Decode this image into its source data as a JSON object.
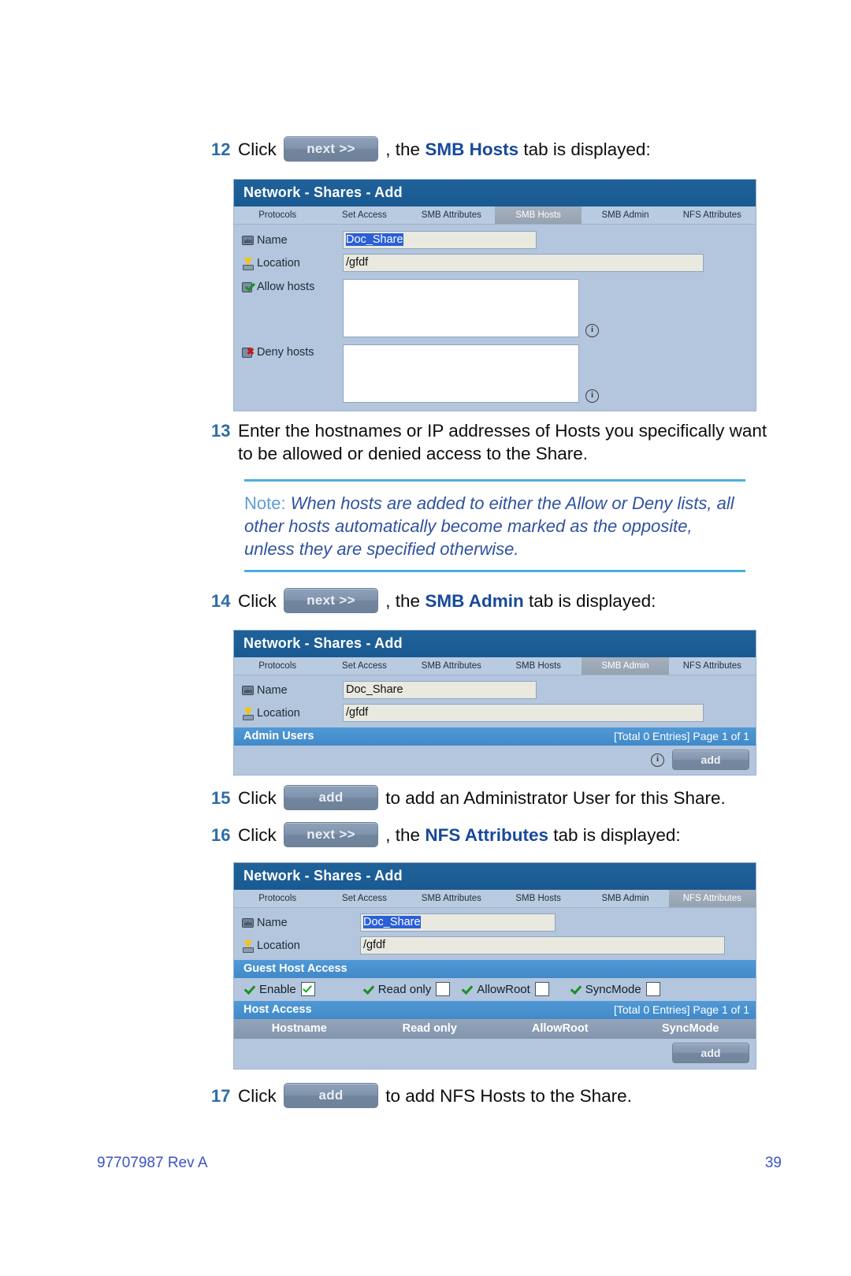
{
  "steps": {
    "s12": {
      "num": "12",
      "pre": "Click",
      "button": "next >>",
      "mid": ", the ",
      "bold": "SMB Hosts",
      "post": " tab is displayed:"
    },
    "s13": {
      "num": "13",
      "text": "Enter the hostnames or IP addresses of Hosts you specifically want to be allowed or denied access to the Share."
    },
    "s14": {
      "num": "14",
      "pre": "Click",
      "button": "next >>",
      "mid": ", the ",
      "bold": "SMB Admin",
      "post": " tab is displayed:"
    },
    "s15": {
      "num": "15",
      "pre": "Click",
      "button": "add",
      "post": "to add an Administrator User for this Share."
    },
    "s16": {
      "num": "16",
      "pre": "Click",
      "button": "next >>",
      "mid": ", the ",
      "bold": "NFS Attributes",
      "post": " tab is displayed:"
    },
    "s17": {
      "num": "17",
      "pre": "Click",
      "button": "add",
      "post": "to add NFS Hosts to the Share."
    }
  },
  "note": {
    "label": "Note:",
    "text": " When hosts are added to either the Allow or Deny lists, all other hosts automatically become marked as the opposite, unless they are specified otherwise."
  },
  "panel_common": {
    "title": "Network - Shares - Add",
    "tabs": [
      "Protocols",
      "Set Access",
      "SMB Attributes",
      "SMB Hosts",
      "SMB Admin",
      "NFS Attributes"
    ],
    "name_label": "Name",
    "location_label": "Location",
    "name_value": "Doc_Share",
    "location_value": "/gfdf",
    "info_glyph": "i"
  },
  "panel_smb_hosts": {
    "active_tab": "SMB Hosts",
    "allow_label": "Allow hosts",
    "deny_label": "Deny hosts",
    "allow_value": "",
    "deny_value": ""
  },
  "panel_smb_admin": {
    "active_tab": "SMB Admin",
    "section_title": "Admin Users",
    "entries_text": "[Total 0 Entries] Page 1 of 1",
    "add_label": "add"
  },
  "panel_nfs_attributes": {
    "active_tab": "NFS Attributes",
    "guest_section_title": "Guest Host Access",
    "checkboxes": [
      {
        "label": "Enable",
        "checked": true
      },
      {
        "label": "Read only",
        "checked": false
      },
      {
        "label": "AllowRoot",
        "checked": false
      },
      {
        "label": "SyncMode",
        "checked": false
      }
    ],
    "host_section_title": "Host Access",
    "entries_text": "[Total 0 Entries] Page 1 of 1",
    "columns": [
      "Hostname",
      "Read only",
      "AllowRoot",
      "SyncMode"
    ],
    "add_label": "add"
  },
  "footer": {
    "doc_id": "97707987 Rev A",
    "page_number": "39"
  },
  "colors": {
    "accent_blue": "#17499b",
    "step_number": "#2d6ca8",
    "note_rule": "#4aaee0",
    "note_label": "#5d9fd0",
    "note_body": "#2f52a0",
    "panel_title_bar": "#1b5b96",
    "panel_bg": "#b3c6dd",
    "section_bar": "#4a90d0",
    "column_header": "#8a9cb4",
    "footer_text": "#3b53c4"
  }
}
